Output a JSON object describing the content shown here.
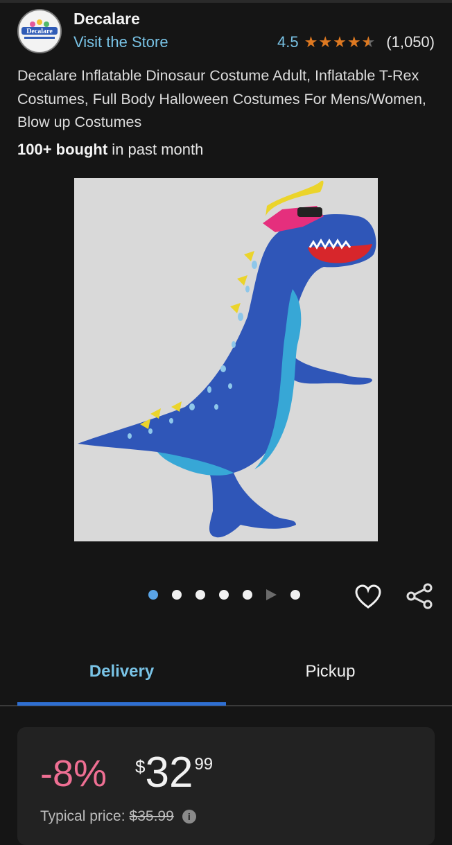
{
  "brand": {
    "name": "Decalare",
    "visit_store": "Visit the Store",
    "logo_text": "Decalare"
  },
  "rating": {
    "value": "4.5",
    "stars": 4.5,
    "count": "(1,050)",
    "star_color": "#de7921"
  },
  "product": {
    "title": "Decalare Inflatable Dinosaur Costume Adult, Inflatable T-Rex Costumes, Full Body Halloween Costumes For Mens/Women, Blow up Costumes",
    "bought_bold": "100+ bought",
    "bought_rest": " in past month"
  },
  "gallery": {
    "image_count": 7,
    "active_index": 0,
    "video_index": 5,
    "active_dot_color": "#5aa4e6"
  },
  "tabs": [
    {
      "label": "Delivery",
      "active": true
    },
    {
      "label": "Pickup",
      "active": false
    }
  ],
  "price": {
    "discount": "-8%",
    "currency": "$",
    "whole": "32",
    "fraction": "99",
    "typical_label": "Typical price:",
    "typical_value": "$35.99",
    "discount_color": "#ee6f93"
  },
  "icons": {
    "wishlist": "heart-icon",
    "share": "share-icon",
    "info": "info-icon"
  }
}
